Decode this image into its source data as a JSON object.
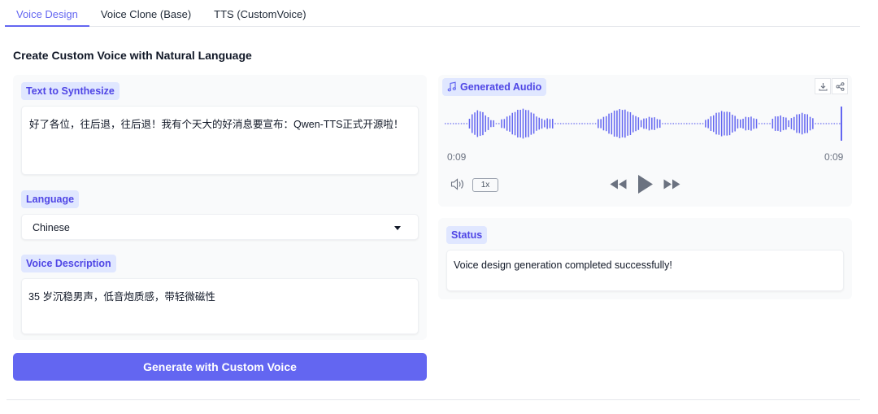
{
  "tabs": [
    {
      "label": "Voice Design",
      "active": true
    },
    {
      "label": "Voice Clone (Base)",
      "active": false
    },
    {
      "label": "TTS (CustomVoice)",
      "active": false
    }
  ],
  "page_title": "Create Custom Voice with Natural Language",
  "text_to_synthesize": {
    "label": "Text to Synthesize",
    "value": "好了各位，往后退，往后退！我有个天大的好消息要宣布：Qwen-TTS正式开源啦！"
  },
  "language": {
    "label": "Language",
    "selected": "Chinese"
  },
  "voice_description": {
    "label": "Voice Description",
    "value": "35 岁沉稳男声，低音炮质感，带轻微磁性"
  },
  "generate_button": {
    "label": "Generate with Custom Voice"
  },
  "generated_audio": {
    "label": "Generated Audio",
    "current_time": "0:09",
    "duration": "0:09",
    "speed": "1x",
    "icons": [
      "music-note-icon",
      "download-icon",
      "share-icon",
      "volume-icon",
      "rewind-icon",
      "play-icon",
      "fast-forward-icon"
    ]
  },
  "status": {
    "label": "Status",
    "message": "Voice design generation completed successfully!"
  },
  "colors": {
    "accent": "#6366f1",
    "chip_bg": "#e0e7ff",
    "chip_text": "#4f46e5"
  }
}
